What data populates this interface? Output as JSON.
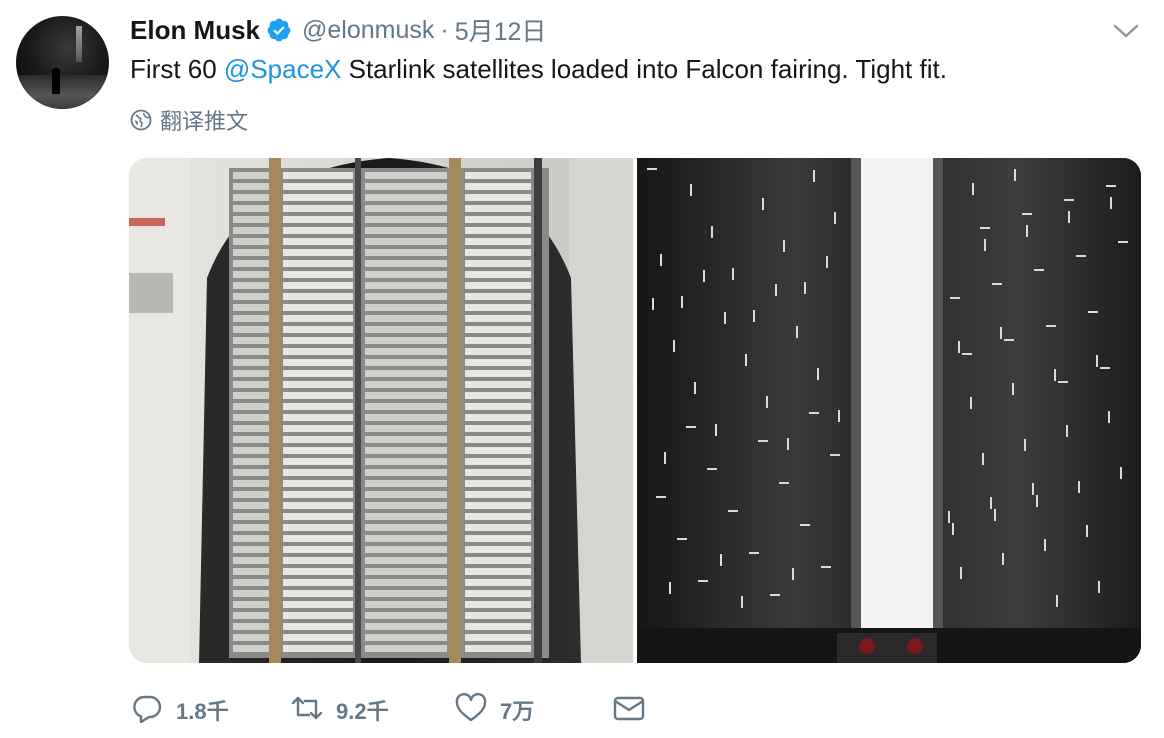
{
  "user": {
    "display_name": "Elon Musk",
    "handle": "@elonmusk",
    "separator": "·",
    "timestamp": "5月12日",
    "verified_icon": "verified-badge-icon",
    "avatar_icon": "avatar"
  },
  "tweet": {
    "text_before": "First 60 ",
    "mention": "@SpaceX",
    "text_after": " Starlink satellites loaded into Falcon fairing. Tight fit."
  },
  "translate": {
    "label": "翻译推文",
    "icon": "globe-icon"
  },
  "media": {
    "photos": [
      "starlink-stack-photo",
      "falcon-fairing-interior-photo"
    ]
  },
  "actions": {
    "reply_count": "1.8千",
    "retweet_count": "9.2千",
    "like_count": "7万",
    "icons": [
      "reply-icon",
      "retweet-icon",
      "like-icon",
      "direct-message-icon"
    ]
  },
  "colors": {
    "text": "#14171a",
    "secondary": "#657786",
    "link": "#1b95e0",
    "verified": "#1da1f2"
  }
}
